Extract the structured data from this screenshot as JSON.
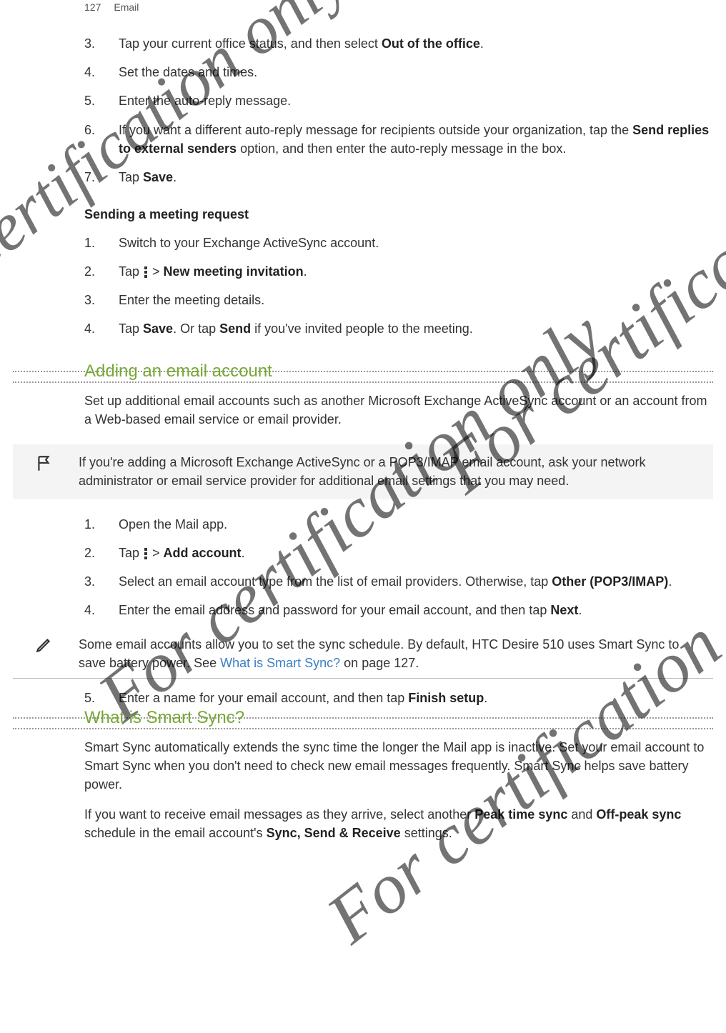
{
  "header": {
    "page_number": "127",
    "section": "Email"
  },
  "watermark": "For certification only",
  "list1": {
    "i3": {
      "n": "3.",
      "pre": "Tap your current office status, and then select ",
      "bold": "Out of the office",
      "post": "."
    },
    "i4": {
      "n": "4.",
      "text": "Set the dates and times."
    },
    "i5": {
      "n": "5.",
      "text": "Enter the auto-reply message."
    },
    "i6": {
      "n": "6.",
      "pre": "If you want a different auto-reply message for recipients outside your organization, tap the ",
      "bold": "Send replies to external senders",
      "post": " option, and then enter the auto-reply message in the box."
    },
    "i7": {
      "n": "7.",
      "pre": "Tap ",
      "bold": "Save",
      "post": "."
    }
  },
  "subhead1": "Sending a meeting request",
  "list2": {
    "i1": {
      "n": "1.",
      "text": "Switch to your Exchange ActiveSync account."
    },
    "i2": {
      "n": "2.",
      "pre": "Tap ",
      "mid": " > ",
      "bold": "New meeting invitation",
      "post": "."
    },
    "i3": {
      "n": "3.",
      "text": "Enter the meeting details."
    },
    "i4": {
      "n": "4.",
      "pre": "Tap ",
      "b1": "Save",
      "mid": ". Or tap ",
      "b2": "Send",
      "post": " if you've invited people to the meeting."
    }
  },
  "h2a": "Adding an email account",
  "p_add": "Set up additional email accounts such as another Microsoft Exchange ActiveSync account or an account from a Web-based email service or email provider.",
  "callout1": "If you're adding a Microsoft Exchange ActiveSync or a POP3/IMAP email account, ask your network administrator or email service provider for additional email settings that you may need.",
  "list3": {
    "i1": {
      "n": "1.",
      "text": "Open the Mail app."
    },
    "i2": {
      "n": "2.",
      "pre": "Tap ",
      "mid": " > ",
      "bold": "Add account",
      "post": "."
    },
    "i3": {
      "n": "3.",
      "pre": "Select an email account type from the list of email providers. Otherwise, tap ",
      "bold": "Other (POP3/IMAP)",
      "post": "."
    },
    "i4": {
      "n": "4.",
      "pre": "Enter the email address and password for your email account, and then tap ",
      "bold": "Next",
      "post": "."
    }
  },
  "callout2": {
    "pre": "Some email accounts allow you to set the sync schedule. By default, HTC Desire 510 uses Smart Sync to save battery power. See ",
    "link": "What is Smart Sync?",
    "post": " on page 127."
  },
  "list4": {
    "i5": {
      "n": "5.",
      "pre": "Enter a name for your email account, and then tap ",
      "bold": "Finish setup",
      "post": "."
    }
  },
  "h2b": "What is Smart Sync?",
  "p_s1": "Smart Sync automatically extends the sync time the longer the Mail app is inactive. Set your email account to Smart Sync when you don't need to check new email messages frequently. Smart Sync helps save battery power.",
  "p_s2": {
    "pre": "If you want to receive email messages as they arrive, select another ",
    "b1": "Peak time sync",
    "mid": " and ",
    "b2": "Off-peak sync",
    "mid2": " schedule in the email account's ",
    "b3": "Sync, Send & Receive",
    "post": " settings."
  }
}
